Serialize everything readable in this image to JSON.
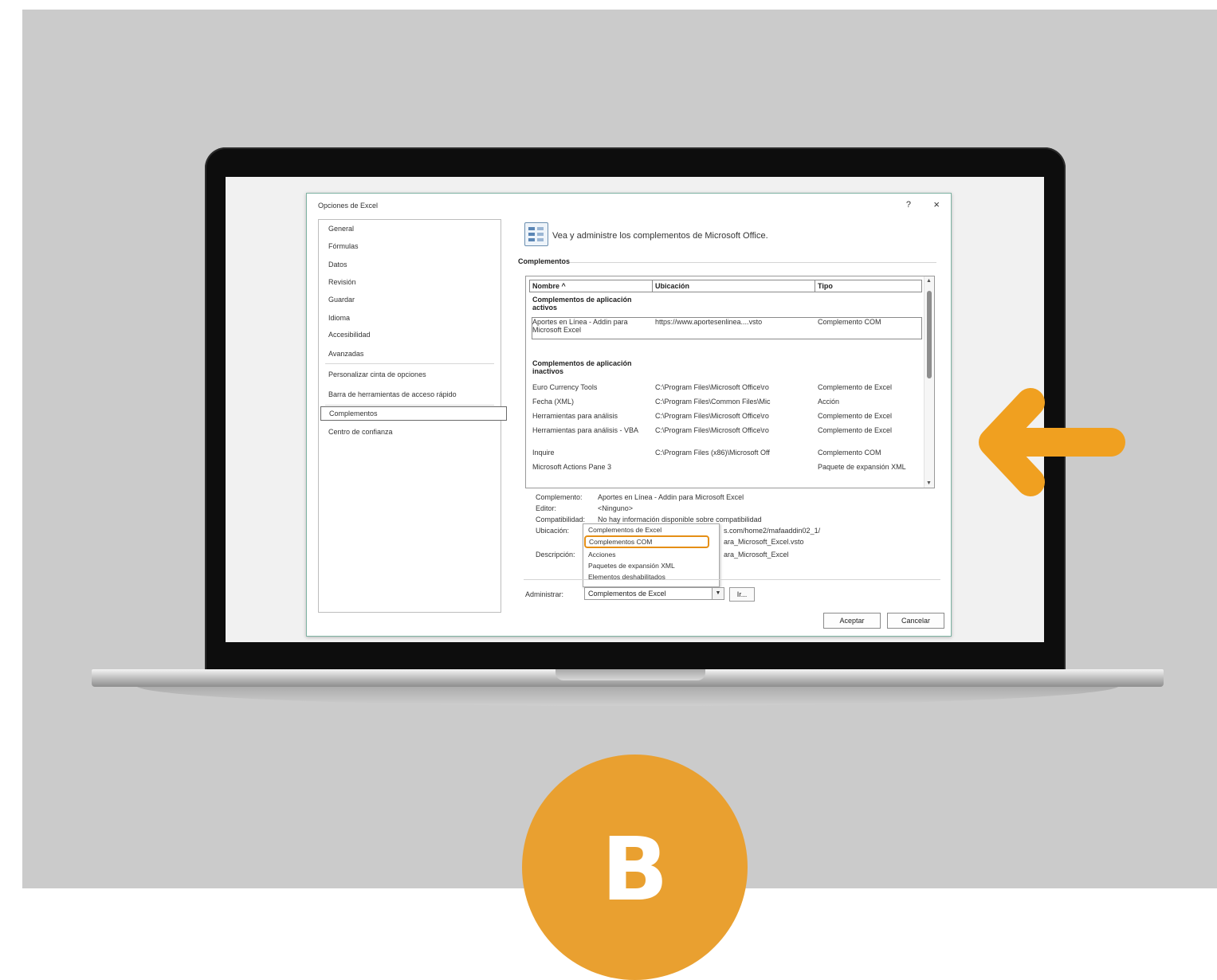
{
  "dialog": {
    "title": "Opciones de Excel",
    "help_label": "?",
    "close_label": "×",
    "heading": "Vea y administre los complementos de Microsoft Office.",
    "section_title": "Complementos"
  },
  "nav": {
    "items": [
      "General",
      "Fórmulas",
      "Datos",
      "Revisión",
      "Guardar",
      "Idioma",
      "Accesibilidad",
      "Avanzadas",
      "Personalizar cinta de opciones",
      "Barra de herramientas de acceso rápido",
      "Complementos",
      "Centro de confianza"
    ],
    "selected": "Complementos"
  },
  "grid": {
    "headers": [
      "Nombre ^",
      "Ubicación",
      "Tipo"
    ],
    "active_group": "Complementos de aplicación activos",
    "active_rows": [
      {
        "name": "Aportes en Línea - Addin para Microsoft Excel",
        "location": "https://www.aportesenlinea....vsto",
        "type": "Complemento COM"
      }
    ],
    "inactive_group": "Complementos de aplicación inactivos",
    "inactive_rows": [
      {
        "name": "Euro Currency Tools",
        "location": "C:\\Program Files\\Microsoft Office\\ro",
        "type": "Complemento de Excel"
      },
      {
        "name": "Fecha (XML)",
        "location": "C:\\Program Files\\Common Files\\Mic",
        "type": "Acción"
      },
      {
        "name": "Herramientas para análisis",
        "location": "C:\\Program Files\\Microsoft Office\\ro",
        "type": "Complemento de Excel"
      },
      {
        "name": "Herramientas para análisis - VBA",
        "location": "C:\\Program Files\\Microsoft Office\\ro",
        "type": "Complemento de Excel"
      },
      {
        "name": "Inquire",
        "location": "C:\\Program Files (x86)\\Microsoft Off",
        "type": "Complemento COM"
      },
      {
        "name": "Microsoft Actions Pane 3",
        "location": "",
        "type": "Paquete de expansión XML"
      }
    ]
  },
  "details": {
    "complemento_label": "Complemento:",
    "complemento_value": "Aportes en Línea - Addin para Microsoft Excel",
    "editor_label": "Editor:",
    "editor_value": "<Ninguno>",
    "compat_label": "Compatibilidad:",
    "compat_value": "No hay información disponible sobre compatibilidad",
    "ubicacion_label": "Ubicación:",
    "ubicacion_value": "s.com/home2/mafaaddin02_1/",
    "ubicacion_value2": "ara_Microsoft_Excel.vsto",
    "descripcion_label": "Descripción:",
    "descripcion_value": "ara_Microsoft_Excel"
  },
  "dropdown": {
    "items": [
      "Complementos de Excel",
      "Complementos COM",
      "Acciones",
      "Paquetes de expansión XML",
      "Elementos deshabilitados"
    ],
    "highlighted": "Complementos COM"
  },
  "admin": {
    "label": "Administrar:",
    "selected": "Complementos de Excel",
    "arrow": "▼",
    "go_label": "Ir..."
  },
  "buttons": {
    "ok": "Aceptar",
    "cancel": "Cancelar"
  },
  "badge": {
    "letter": "B"
  },
  "colors": {
    "accent_orange": "#f0a020",
    "badge_orange": "#e9a030",
    "background": "#cbcbcb"
  }
}
